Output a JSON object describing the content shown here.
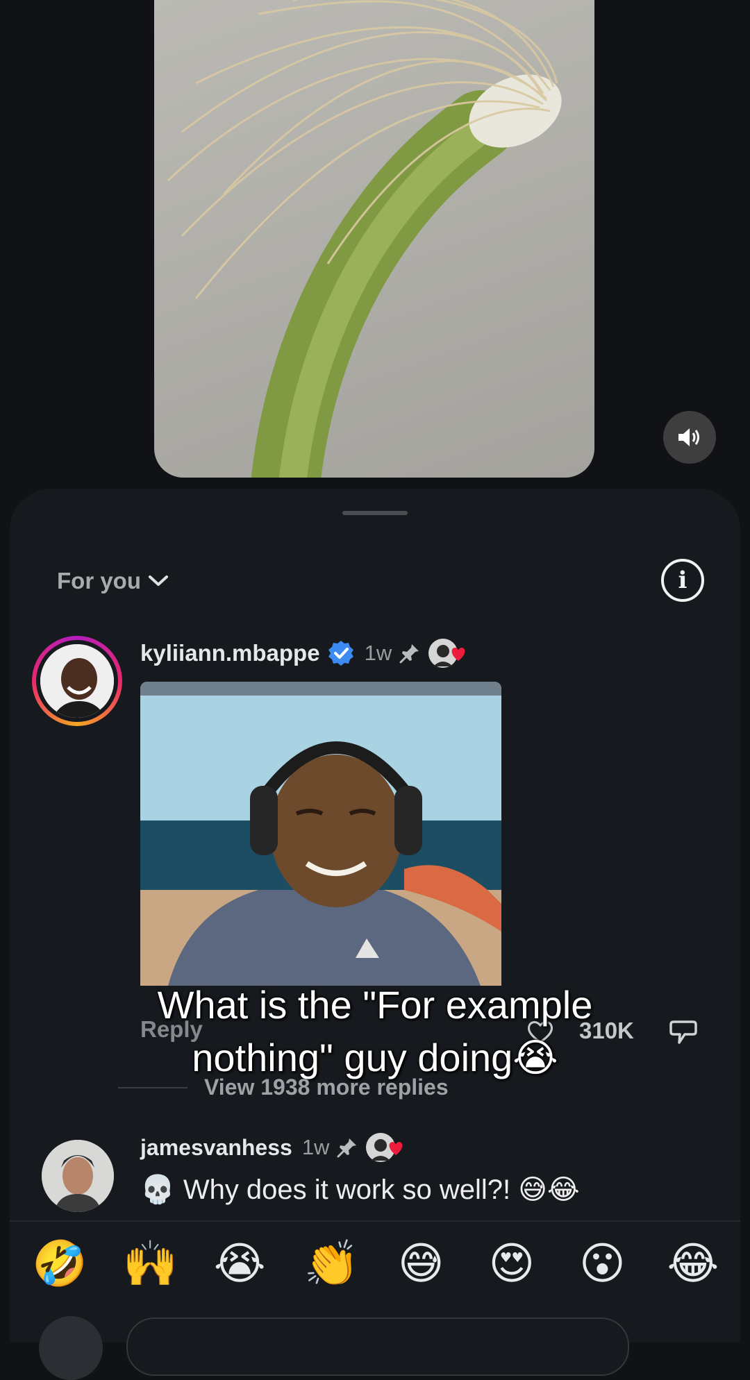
{
  "video": {
    "sound_icon": "speaker-icon"
  },
  "sheet": {
    "filter_label": "For you",
    "info_icon_glyph": "i"
  },
  "comment1": {
    "username": "kyliiann.mbappe",
    "time": "1w",
    "verified_icon": "verified-badge-icon",
    "pinned_icon": "pin-icon",
    "reply_label": "Reply",
    "like_count": "310K",
    "view_more": "View 1938 more replies"
  },
  "caption": {
    "line1": "What is the \"For example",
    "line2": "nothing\" guy doing😭"
  },
  "comment2": {
    "username": "jamesvanhess",
    "time": "1w",
    "skull": "💀",
    "text": "Why does it work so well?! 😅😂"
  },
  "emoji_bar": [
    "🤣",
    "🙌",
    "😭",
    "👏",
    "😅",
    "😍",
    "😮",
    "😂"
  ],
  "colors": {
    "background": "#101216",
    "sheet": "#16191d",
    "verified": "#3d8bf2",
    "heart": "#ee1d3b"
  }
}
